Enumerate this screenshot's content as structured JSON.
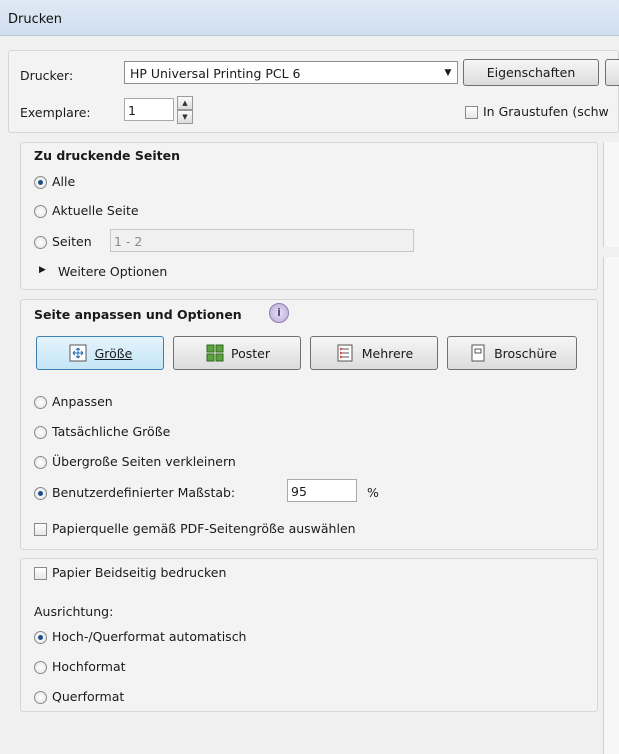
{
  "window": {
    "title": "Drucken"
  },
  "printer": {
    "label": "Drucker:",
    "selected": "HP Universal Printing PCL 6",
    "properties_button": "Eigenschaften",
    "copies_label": "Exemplare:",
    "copies_value": "1",
    "grayscale_label": "In Graustufen (schw"
  },
  "pages": {
    "heading": "Zu druckende Seiten",
    "all": "Alle",
    "current": "Aktuelle Seite",
    "pages_label": "Seiten",
    "pages_value": "1 - 2",
    "more": "Weitere Optionen"
  },
  "sizing": {
    "heading": "Seite anpassen und Optionen",
    "buttons": {
      "size": "Größe",
      "poster": "Poster",
      "multiple": "Mehrere",
      "booklet": "Broschüre"
    },
    "fit": "Anpassen",
    "actual": "Tatsächliche Größe",
    "shrink": "Übergroße Seiten verkleinern",
    "custom": "Benutzerdefinierter Maßstab:",
    "custom_value": "95",
    "percent": "%",
    "paper_source": "Papierquelle gemäß PDF-Seitengröße auswählen"
  },
  "duplex": {
    "both_sides": "Papier Beidseitig bedrucken",
    "orientation_label": "Ausrichtung:",
    "auto": "Hoch-/Querformat automatisch",
    "portrait": "Hochformat",
    "landscape": "Querformat"
  }
}
